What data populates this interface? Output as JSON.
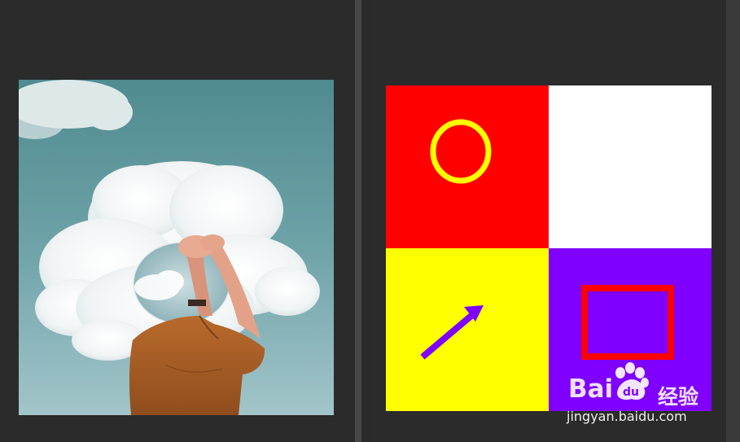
{
  "colors": {
    "app_bg": "#2b2b2b",
    "divider": "#474747",
    "quad_red": "#ff0000",
    "quad_white": "#ffffff",
    "quad_yellow": "#ffff00",
    "quad_purple": "#7f00ff",
    "circle_stroke": "#ffff00",
    "arrow_fill": "#7f00ff",
    "square_stroke": "#ff0000"
  },
  "left_document": {
    "image_description_icon": "sky-cloud-mirror-photo"
  },
  "right_document": {
    "quadrants": [
      "red",
      "white",
      "yellow",
      "purple"
    ],
    "shapes": [
      "circle-icon",
      "arrow-icon",
      "square-icon"
    ]
  },
  "watermark": {
    "logo_left": "Bai",
    "logo_right": "经验",
    "url": "jingyan.baidu.com"
  }
}
